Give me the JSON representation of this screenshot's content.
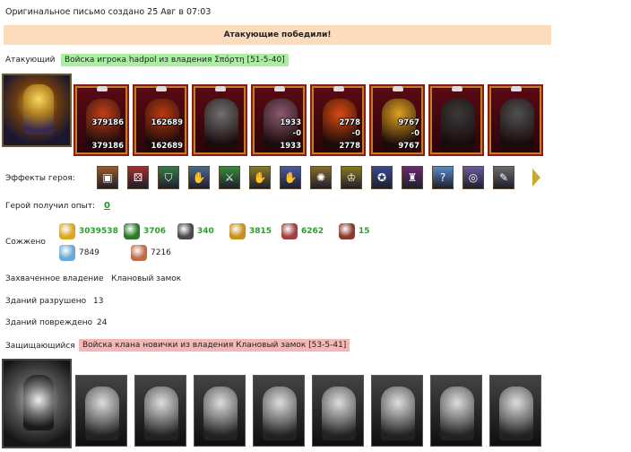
{
  "header": {
    "created": "Оригинальное письмо создано 25 Авг в 07:03",
    "result_banner": "Атакующие победили!"
  },
  "attacker": {
    "label": "Атакующий",
    "name": "Войска игрока hadpol из владения Σπόρτη [51-5-40]",
    "units": [
      {
        "top": "379186",
        "bottom": "379186",
        "color": "#c04018"
      },
      {
        "top": "162689",
        "bottom": "162689",
        "color": "#b83a10"
      },
      {
        "top": "",
        "bottom": "",
        "color": "#707070"
      },
      {
        "top": "1933",
        "mid": "-0",
        "bottom": "1933",
        "color": "#8a5a70"
      },
      {
        "top": "2778",
        "mid": "-0",
        "bottom": "2778",
        "color": "#d84a10"
      },
      {
        "top": "9767",
        "mid": "-0",
        "bottom": "9767",
        "color": "#e0a020"
      },
      {
        "top": "",
        "bottom": "",
        "color": "#3a3a3a"
      },
      {
        "top": "",
        "bottom": "",
        "color": "#505050"
      }
    ]
  },
  "effects": {
    "label": "Эффекты героя:",
    "icons": [
      "chest-icon",
      "dice-icon",
      "shield-icon",
      "handshake-shield-icon",
      "sword-icon",
      "handshake-icon",
      "hand-icon",
      "gear-bag-icon",
      "crown-helm-icon",
      "star-seal-icon",
      "armor-icon",
      "question-icon",
      "ring-icon",
      "quill-icon"
    ],
    "glyphs": [
      "▣",
      "⚄",
      "⛉",
      "✋",
      "⚔",
      "✋",
      "✋",
      "✺",
      "♔",
      "✪",
      "♜",
      "?",
      "◎",
      "✎"
    ],
    "colors": [
      "#9a5a2a",
      "#a0302a",
      "#3a7a4a",
      "#4a6a8a",
      "#3a8a3a",
      "#8a7a2a",
      "#4a5aa0",
      "#8a6a2a",
      "#8a7a20",
      "#3a4a8a",
      "#6a2a6a",
      "#5a8ac8",
      "#6a5a9a",
      "#6a6a6a"
    ]
  },
  "experience": {
    "label": "Герой получил опыт:",
    "value": "0"
  },
  "burned": {
    "label": "Сожжено",
    "row1": [
      {
        "icon": "gold-icon",
        "value": "3039538",
        "color": "#d8a820"
      },
      {
        "icon": "wood-icon",
        "value": "3706",
        "color": "#2a7a2a"
      },
      {
        "icon": "ore-icon",
        "value": "340",
        "color": "#4a4a4a"
      },
      {
        "icon": "wheat-icon",
        "value": "3815",
        "color": "#c8901a"
      },
      {
        "icon": "meat-icon",
        "value": "6262",
        "color": "#a04040"
      },
      {
        "icon": "torch-icon",
        "value": "15",
        "color": "#8a3a2a"
      }
    ],
    "row2": [
      {
        "icon": "crystal-icon",
        "value": "7849",
        "color": "#6aa8d8"
      },
      {
        "icon": "scroll-icon",
        "value": "7216",
        "color": "#c06a4a"
      }
    ]
  },
  "captured": {
    "label": "Захваченное владение",
    "value": "Клановый замок"
  },
  "destroyed": {
    "label": "Зданий разрушено",
    "value": "13"
  },
  "damaged": {
    "label": "Зданий повреждено",
    "value": "24"
  },
  "defender": {
    "label": "Защищающийся",
    "name": "Войска клана новички из владения Клановый замок [53-5-41]",
    "units_count": 8
  }
}
